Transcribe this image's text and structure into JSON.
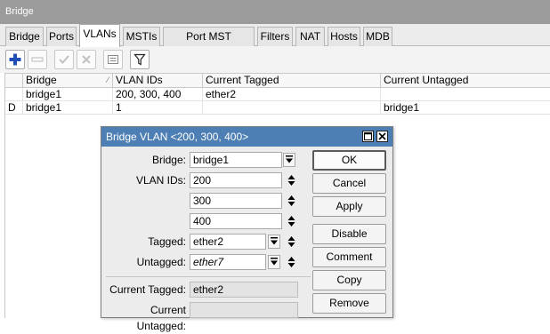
{
  "window": {
    "title": "Bridge"
  },
  "tabs": [
    {
      "label": "Bridge"
    },
    {
      "label": "Ports"
    },
    {
      "label": "VLANs"
    },
    {
      "label": "MSTIs"
    },
    {
      "label": "Port MST Overrides"
    },
    {
      "label": "Filters"
    },
    {
      "label": "NAT"
    },
    {
      "label": "Hosts"
    },
    {
      "label": "MDB"
    }
  ],
  "active_tab": "VLANs",
  "toolbar": {
    "add_icon": "plus-icon",
    "remove_icon": "minus-icon",
    "enable_icon": "check-icon",
    "disable_icon": "x-icon",
    "comment_icon": "comment-icon",
    "filter_icon": "filter-icon"
  },
  "table": {
    "columns": [
      "",
      "Bridge",
      "VLAN IDs",
      "Current Tagged",
      "Current Untagged"
    ],
    "rows": [
      {
        "flag": "",
        "bridge": "bridge1",
        "vlan_ids": "200, 300, 400",
        "current_tagged": "ether2",
        "current_untagged": ""
      },
      {
        "flag": "D",
        "bridge": "bridge1",
        "vlan_ids": "1",
        "current_tagged": "",
        "current_untagged": "bridge1"
      }
    ]
  },
  "dialog": {
    "title": "Bridge VLAN <200, 300, 400>",
    "fields": {
      "bridge_label": "Bridge:",
      "bridge_value": "bridge1",
      "vlan_ids_label": "VLAN IDs:",
      "vlan_ids_values": [
        "200",
        "300",
        "400"
      ],
      "tagged_label": "Tagged:",
      "tagged_value": "ether2",
      "untagged_label": "Untagged:",
      "untagged_value": "ether7",
      "current_tagged_label": "Current Tagged:",
      "current_tagged_value": "ether2",
      "current_untagged_label": "Current Untagged:",
      "current_untagged_value": ""
    },
    "buttons": {
      "ok": "OK",
      "cancel": "Cancel",
      "apply": "Apply",
      "disable": "Disable",
      "comment": "Comment",
      "copy": "Copy",
      "remove": "Remove"
    }
  },
  "colors": {
    "title_bar": "#9b9b9b",
    "dialog_title_bar": "#4e7fb4",
    "add_icon": "#1f4fb6"
  }
}
